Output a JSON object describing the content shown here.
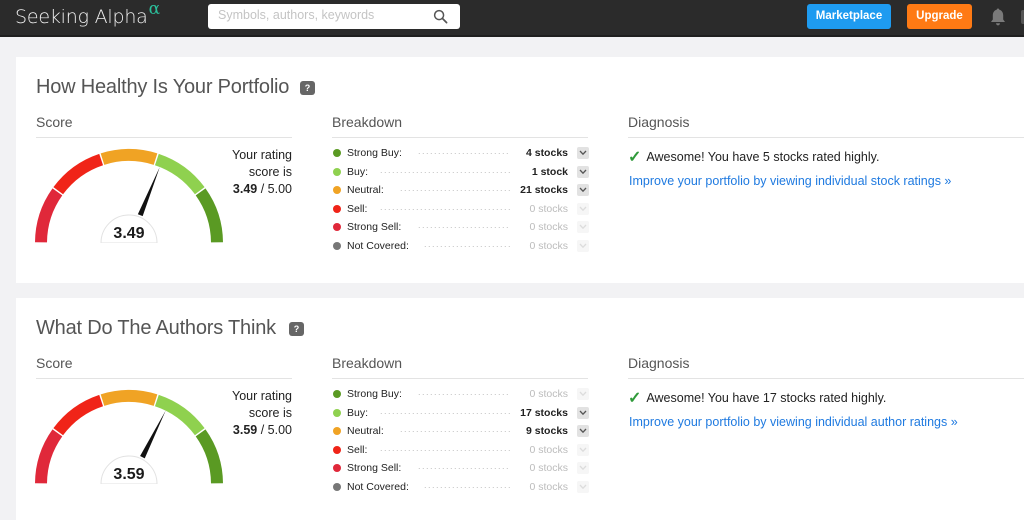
{
  "header": {
    "logo_text": "Seeking Alpha",
    "logo_symbol": "α",
    "search_placeholder": "Symbols, authors, keywords",
    "search_value": "",
    "marketplace_label": "Marketplace",
    "upgrade_label": "Upgrade",
    "icons": {
      "search": "search-icon",
      "notifications": "bell-icon"
    }
  },
  "colors": {
    "marketplace": "#1e9bf0",
    "upgrade": "#ff7a14",
    "strong_buy": "#5a9a23",
    "buy": "#8fd14f",
    "neutral": "#f0a324",
    "sell": "#f02418",
    "strong_sell": "#e0283a",
    "not_covered": "#777777",
    "link": "#1f7ae0",
    "check": "#2f9a3a"
  },
  "panels": [
    {
      "title": "How Healthy Is Your Portfolio",
      "help_label": "?",
      "score_heading": "Score",
      "breakdown_heading": "Breakdown",
      "diagnosis_heading": "Diagnosis",
      "score": {
        "value": 3.49,
        "display": "3.49",
        "max_display": "5.00",
        "label_line1": "Your rating",
        "label_line2": "score is",
        "separator": " / "
      },
      "breakdown": [
        {
          "label": "Strong Buy:",
          "count": "4 stocks",
          "zero": false,
          "key": "strong_buy"
        },
        {
          "label": "Buy:",
          "count": "1 stock",
          "zero": false,
          "key": "buy"
        },
        {
          "label": "Neutral:",
          "count": "21 stocks",
          "zero": false,
          "key": "neutral"
        },
        {
          "label": "Sell:",
          "count": "0 stocks",
          "zero": true,
          "key": "sell"
        },
        {
          "label": "Strong Sell:",
          "count": "0 stocks",
          "zero": true,
          "key": "strong_sell"
        },
        {
          "label": "Not Covered:",
          "count": "0 stocks",
          "zero": true,
          "key": "not_covered"
        }
      ],
      "diagnosis": {
        "check": "✓",
        "message": "Awesome! You have 5 stocks rated highly.",
        "link": "Improve your portfolio by viewing individual stock ratings »"
      }
    },
    {
      "title": "What Do The Authors Think",
      "help_label": "?",
      "score_heading": "Score",
      "breakdown_heading": "Breakdown",
      "diagnosis_heading": "Diagnosis",
      "score": {
        "value": 3.59,
        "display": "3.59",
        "max_display": "5.00",
        "label_line1": "Your rating",
        "label_line2": "score is",
        "separator": " / "
      },
      "breakdown": [
        {
          "label": "Strong Buy:",
          "count": "0 stocks",
          "zero": true,
          "key": "strong_buy"
        },
        {
          "label": "Buy:",
          "count": "17 stocks",
          "zero": false,
          "key": "buy"
        },
        {
          "label": "Neutral:",
          "count": "9 stocks",
          "zero": false,
          "key": "neutral"
        },
        {
          "label": "Sell:",
          "count": "0 stocks",
          "zero": true,
          "key": "sell"
        },
        {
          "label": "Strong Sell:",
          "count": "0 stocks",
          "zero": true,
          "key": "strong_sell"
        },
        {
          "label": "Not Covered:",
          "count": "0 stocks",
          "zero": true,
          "key": "not_covered"
        }
      ],
      "diagnosis": {
        "check": "✓",
        "message": "Awesome! You have 17 stocks rated highly.",
        "link": "Improve your portfolio by viewing individual author ratings »"
      }
    }
  ]
}
